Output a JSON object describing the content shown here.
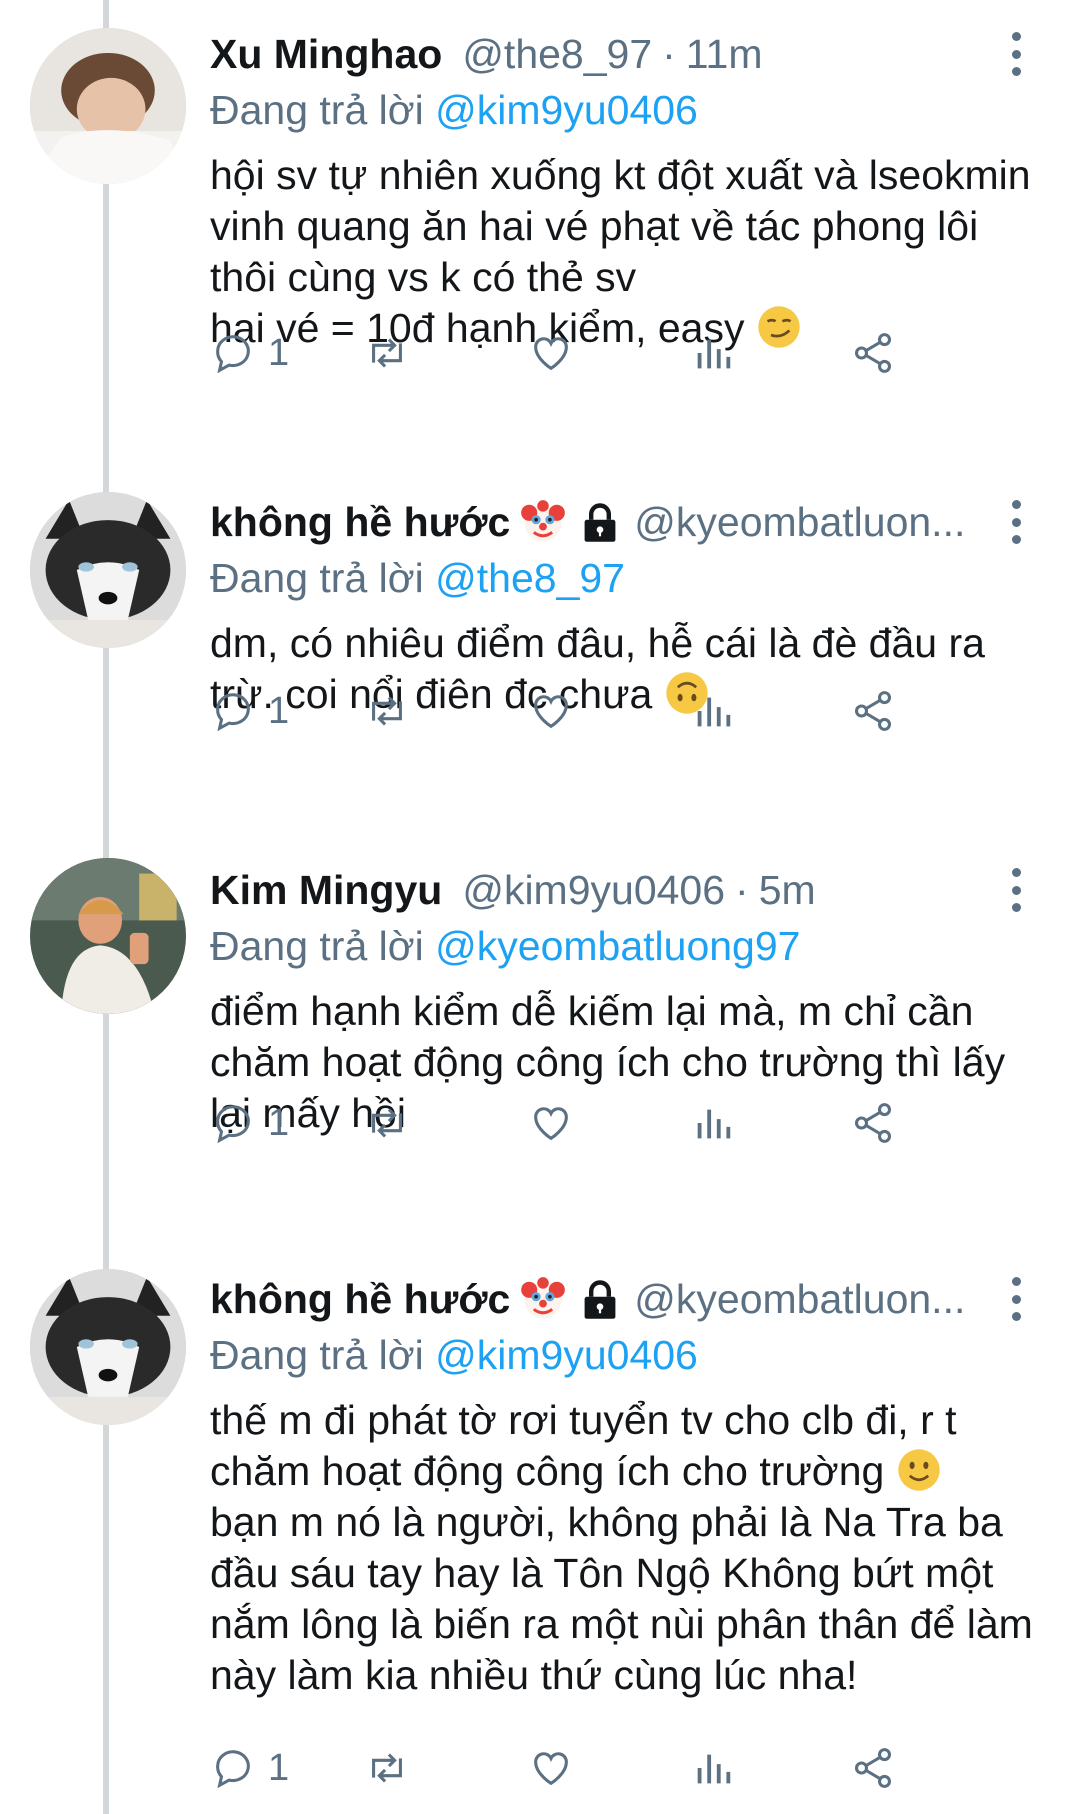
{
  "reply_prefix": "Đang trả lời",
  "tweets": [
    {
      "name": "Xu Minghao",
      "handle": "@the8_97",
      "time": "11m",
      "reply_to": "@kim9yu0406",
      "text": "hội sv tự nhiên xuống kt đột xuất và lseokmin vinh quang ăn hai vé phạt về tác phong lôi thôi cùng vs k có thẻ sv\nhai vé = 10đ hạnh kiểm, easy",
      "text_emoji": "smirking-face",
      "reply_count": "1"
    },
    {
      "name": "không hề hước",
      "handle": "@kyeombatluon...",
      "time": "",
      "reply_to": "@the8_97",
      "text": "dm, có nhiêu điểm đâu, hễ cái là đè đầu ra trừ. coi nổi điên đc chưa",
      "text_emoji": "upside-down-face",
      "reply_count": "1"
    },
    {
      "name": "Kim Mingyu",
      "handle": "@kim9yu0406",
      "time": "5m",
      "reply_to": "@kyeombatluong97",
      "text": "điểm hạnh kiểm dễ kiếm lại mà, m chỉ cần chăm hoạt động công ích cho trường thì lấy lại mấy hồi",
      "text_emoji": "",
      "reply_count": "1"
    },
    {
      "name": "không hề hước",
      "handle": "@kyeombatluon...",
      "time": "",
      "reply_to": "@kim9yu0406",
      "text_a": "thế m đi phát tờ rơi tuyển tv cho clb đi, r t chăm hoạt động công ích cho trường",
      "text_b": "bạn m nó là người, không phải là Na Tra ba đầu sáu tay hay là Tôn Ngộ Không bứt một nắm lông là biến ra một nùi phân thân để làm này làm kia nhiều thứ cùng lúc nha!",
      "text_emoji": "slightly-smiling-face",
      "reply_count": "1"
    }
  ],
  "icons": {
    "reply": "reply-bubble-icon",
    "retweet": "retweet-icon",
    "like": "heart-icon",
    "stats": "analytics-icon",
    "share": "share-icon",
    "more": "more-vertical-icon",
    "clown": "clown-face-emoji",
    "lock": "padlock-icon"
  },
  "colors": {
    "text": "#14171a",
    "secondary": "#5b7083",
    "link": "#1da1f2",
    "thread_line": "#d4d7da",
    "emoji_yellow": "#f7c843"
  }
}
